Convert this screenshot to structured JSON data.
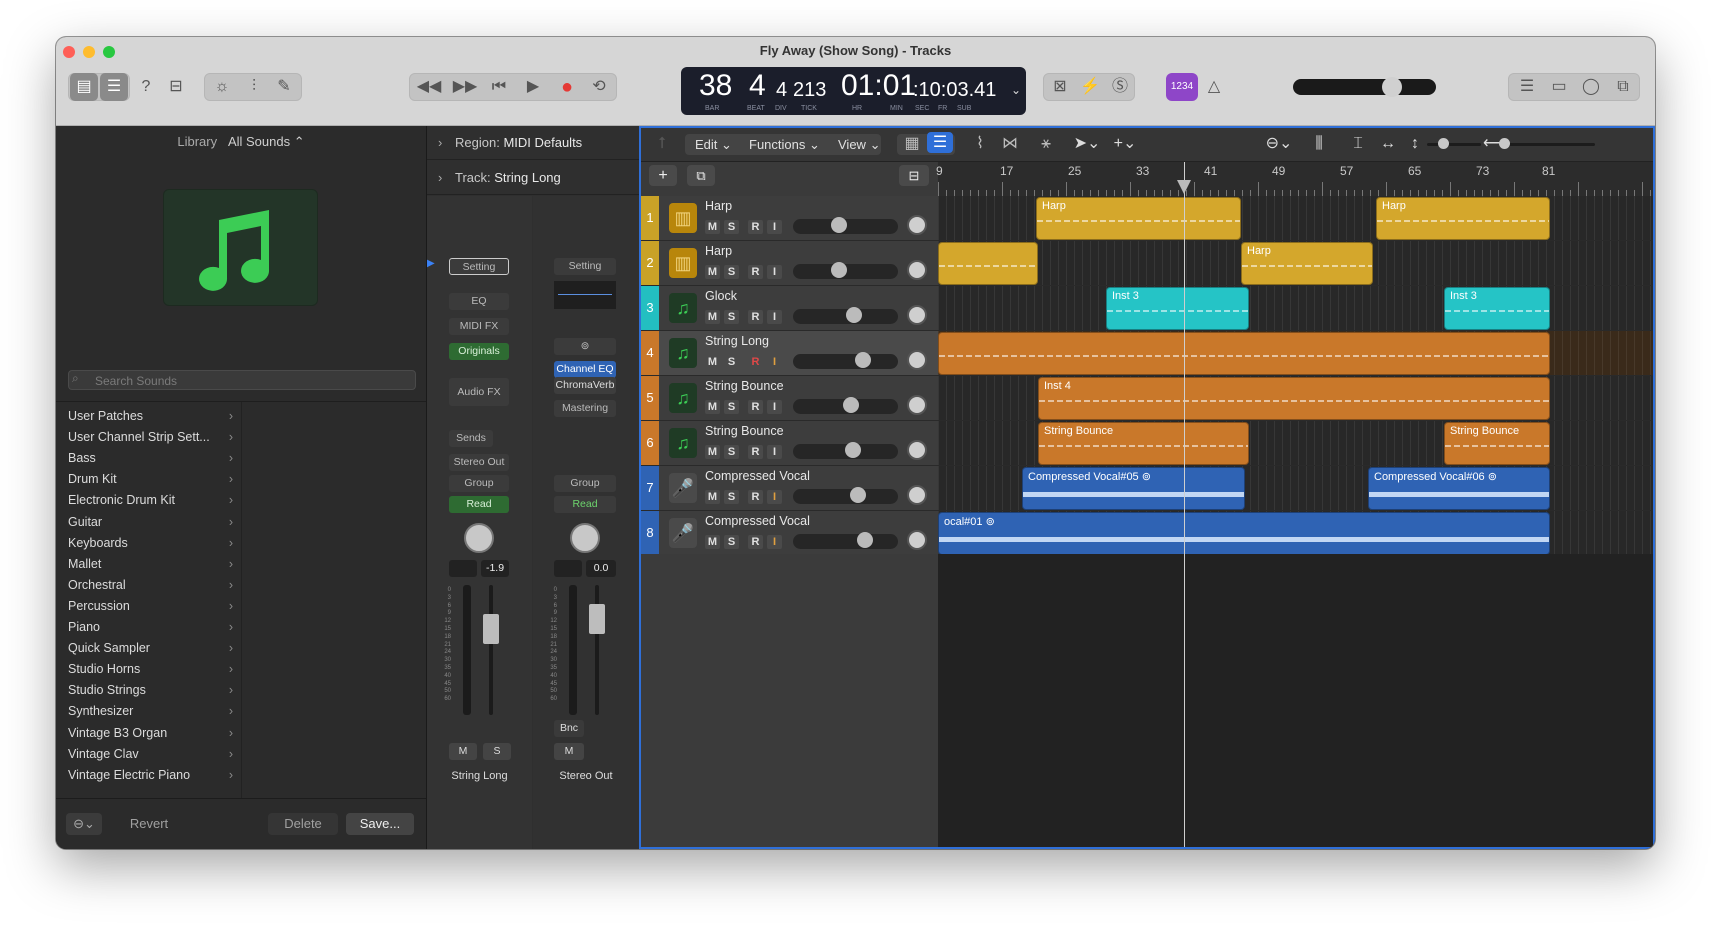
{
  "window": {
    "title": "Fly Away (Show Song) - Tracks"
  },
  "lcd": {
    "bar": "38",
    "beat": "4",
    "div": "4",
    "tick": "213",
    "time_main": "01:01",
    "time_small": ":10:03.41",
    "labels": {
      "bar": "BAR",
      "beat": "BEAT",
      "div": "DIV",
      "tick": "TICK",
      "hr": "HR",
      "min": "MIN",
      "sec": "SEC",
      "fr": "FR",
      "sub": "SUB"
    },
    "key_badge": "1234"
  },
  "library": {
    "header_label": "Library",
    "header_selector": "All Sounds",
    "search_placeholder": "Search Sounds",
    "items": [
      "User Patches",
      "User Channel Strip Sett...",
      "Bass",
      "Drum Kit",
      "Electronic Drum Kit",
      "Guitar",
      "Keyboards",
      "Mallet",
      "Orchestral",
      "Percussion",
      "Piano",
      "Quick Sampler",
      "Studio Horns",
      "Studio Strings",
      "Synthesizer",
      "Vintage B3 Organ",
      "Vintage Clav",
      "Vintage Electric Piano"
    ],
    "footer": {
      "revert": "Revert",
      "delete": "Delete",
      "save": "Save..."
    }
  },
  "inspector": {
    "region_label": "Region:",
    "region_value": "MIDI Defaults",
    "track_label": "Track:",
    "track_value": "String Long",
    "strip1": {
      "setting": "Setting",
      "eq": "EQ",
      "midi_fx": "MIDI FX",
      "instrument": "Originals",
      "audio_fx": "Audio FX",
      "sends": "Sends",
      "output": "Stereo Out",
      "group": "Group",
      "automation": "Read",
      "value": "-1.9",
      "mute": "M",
      "solo": "S",
      "name": "String Long"
    },
    "strip2": {
      "setting": "Setting",
      "plugin1": "Channel EQ",
      "plugin2": "ChromaVerb",
      "mastering": "Mastering",
      "group": "Group",
      "automation": "Read",
      "value": "0.0",
      "bounce": "Bnc",
      "mute": "M",
      "name": "Stereo Out"
    },
    "scale": [
      "0",
      "3",
      "6",
      "9",
      "12",
      "15",
      "18",
      "21",
      "24",
      "30",
      "35",
      "40",
      "45",
      "50",
      "60"
    ]
  },
  "tracks_toolbar": {
    "edit": "Edit",
    "functions": "Functions",
    "view": "View"
  },
  "ruler": [
    "9",
    "17",
    "25",
    "33",
    "41",
    "49",
    "57",
    "65",
    "73",
    "81"
  ],
  "tracks": [
    {
      "num": "1",
      "name": "Harp",
      "color": "#c9a227"
    },
    {
      "num": "2",
      "name": "Harp",
      "color": "#c9a227"
    },
    {
      "num": "3",
      "name": "Glock",
      "color": "#23bfc1"
    },
    {
      "num": "4",
      "name": "String Long",
      "color": "#c9782a"
    },
    {
      "num": "5",
      "name": "String Bounce",
      "color": "#c9782a"
    },
    {
      "num": "6",
      "name": "String Bounce",
      "color": "#c9782a"
    },
    {
      "num": "7",
      "name": "Compressed Vocal",
      "color": "#2f63b4"
    },
    {
      "num": "8",
      "name": "Compressed Vocal",
      "color": "#2f63b4"
    }
  ],
  "track_buttons": {
    "m": "M",
    "s": "S",
    "r": "R",
    "i": "I"
  },
  "regions": {
    "harp_a": "Harp",
    "harp_b": "Harp",
    "harp_c": "Harp",
    "inst3_a": "Inst 3",
    "inst3_b": "Inst 3",
    "inst4": "Inst 4",
    "sb_a": "String Bounce",
    "sb_b": "String Bounce",
    "cv_a": "Compressed Vocal#05",
    "cv_b": "Compressed Vocal#06",
    "cv_c": "ocal#01"
  }
}
